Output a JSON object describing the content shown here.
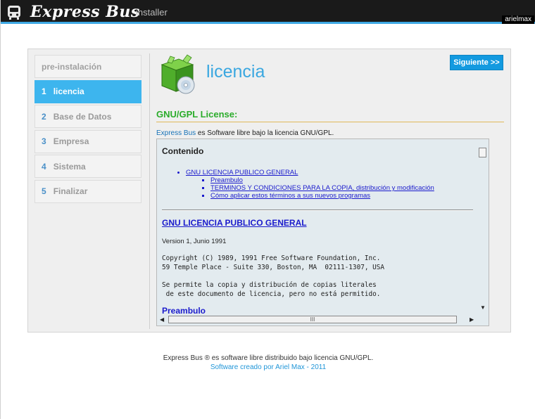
{
  "app": {
    "brand": "Express Bus",
    "subtitle": "installer",
    "user": "arielmax"
  },
  "sidebar": {
    "items": [
      {
        "num": "",
        "label": "pre-instalación"
      },
      {
        "num": "1",
        "label": "licencia"
      },
      {
        "num": "2",
        "label": "Base de Datos"
      },
      {
        "num": "3",
        "label": "Empresa"
      },
      {
        "num": "4",
        "label": "Sistema"
      },
      {
        "num": "5",
        "label": "Finalizar"
      }
    ]
  },
  "main": {
    "title": "licencia",
    "next_button": "Siguiente >>",
    "section_title": "GNU/GPL License:",
    "intro_link": "Express Bus",
    "intro_text": " es Software libre bajo la licencia GNU/GPL."
  },
  "license": {
    "contents_heading": "Contenido",
    "toc_main": "GNU LICENCIA PUBLICO GENERAL",
    "toc_sub": [
      "Preambulo",
      "TERMINOS Y CONDICIONES PARA LA COPIA, distribución y modificación",
      "Cómo aplicar estos términos a sus nuevos programas"
    ],
    "section_heading": "GNU LICENCIA PUBLICO GENERAL",
    "version": "Version 1, Junio 1991",
    "copyright_block": "Copyright (C) 1989, 1991 Free Software Foundation, Inc.\n59 Temple Place - Suite 330, Boston, MA  02111-1307, USA",
    "permission_block": "Se permite la copia y distribución de copias literales\n de este documento de licencia, pero no está permitido.",
    "preambulo_heading": "Preambulo",
    "scroll_grip": "III"
  },
  "footer": {
    "line1": "Express Bus ® es software libre distribuido bajo licencia GNU/GPL.",
    "line2": "Software creado por Ariel Max - 2011"
  }
}
